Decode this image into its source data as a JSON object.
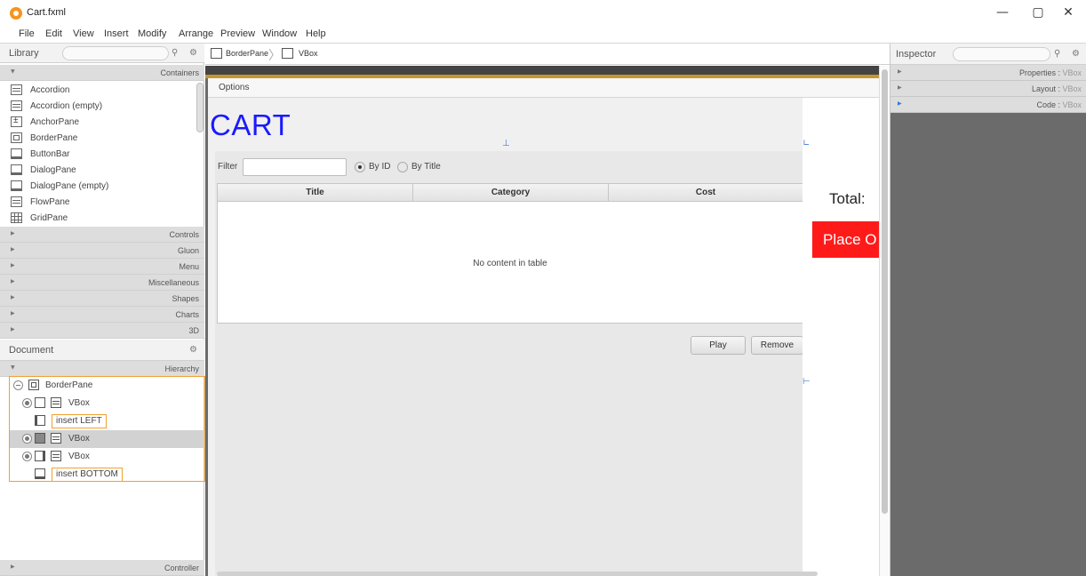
{
  "window": {
    "title": "Cart.fxml",
    "minimize": "—",
    "maximize": "▢",
    "close": "✕"
  },
  "menu": [
    "File",
    "Edit",
    "View",
    "Insert",
    "Modify",
    "Arrange",
    "Preview",
    "Window",
    "Help"
  ],
  "library": {
    "title": "Library",
    "search_placeholder": "",
    "containers_label": "Containers",
    "items": [
      "Accordion",
      "Accordion  (empty)",
      "AnchorPane",
      "BorderPane",
      "ButtonBar",
      "DialogPane",
      "DialogPane  (empty)",
      "FlowPane",
      "GridPane"
    ],
    "sections": [
      "Controls",
      "Gluon",
      "Menu",
      "Miscellaneous",
      "Shapes",
      "Charts",
      "3D"
    ]
  },
  "document": {
    "title": "Document",
    "hierarchy_label": "Hierarchy",
    "tree": {
      "root": "BorderPane",
      "vbox1": "VBox",
      "insert_left": "insert LEFT",
      "vbox2": "VBox",
      "vbox3": "VBox",
      "insert_bottom": "insert BOTTOM"
    },
    "controller_label": "Controller"
  },
  "breadcrumb": [
    "BorderPane",
    "VBox"
  ],
  "form": {
    "menu_label": "Options",
    "title": "CART",
    "filter_label": "Filter",
    "filter_value": "",
    "radio_by_id": "By ID",
    "radio_by_title": "By Title",
    "table_columns": [
      "Title",
      "Category",
      "Cost"
    ],
    "table_empty": "No content in table",
    "play_button": "Play",
    "remove_button": "Remove",
    "total_label": "Total:",
    "place_order_button": "Place O"
  },
  "inspector": {
    "title": "Inspector",
    "sections": [
      {
        "name": "Properties",
        "target": "VBox"
      },
      {
        "name": "Layout",
        "target": "VBox"
      },
      {
        "name": "Code",
        "target": "VBox"
      }
    ]
  },
  "colors": {
    "cart_title": "#1a1aff",
    "place_order_bg": "#ff1a1a",
    "insert_highlight": "#f0a030",
    "canvas_bg": "#6b6b6b"
  }
}
